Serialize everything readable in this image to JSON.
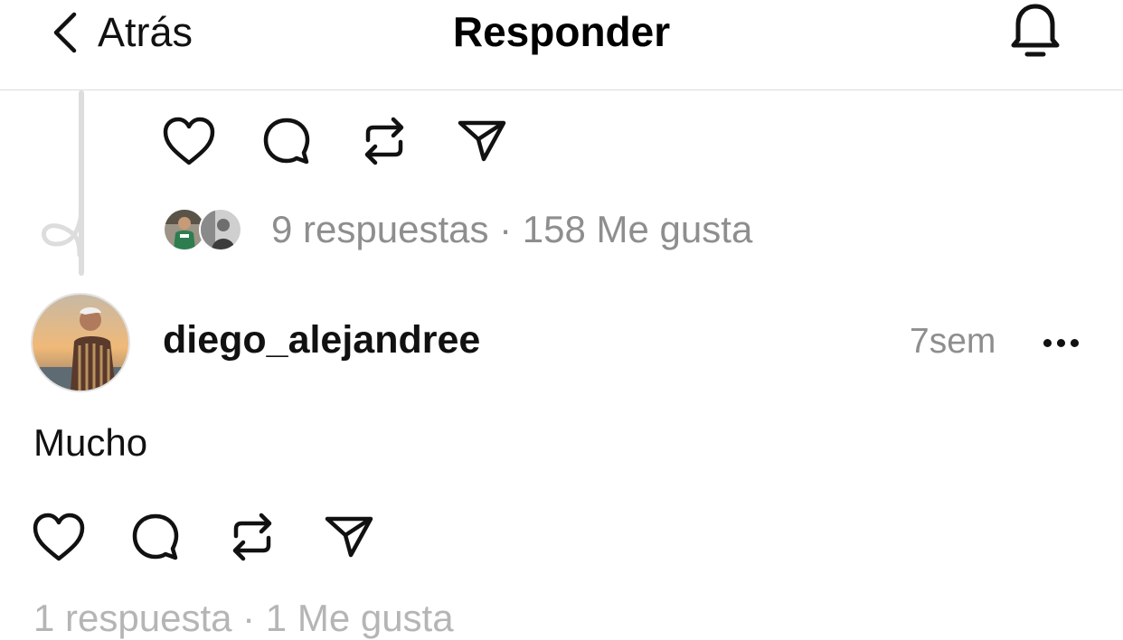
{
  "header": {
    "back_label": "Atrás",
    "title": "Responder",
    "icons": {
      "back": "chevron-left-icon",
      "notifications": "bell-icon"
    }
  },
  "previous_post": {
    "stats": "9 respuestas · 158 Me gusta"
  },
  "post": {
    "username": "diego_alejandree",
    "time": "7sem",
    "text": "Mucho",
    "stats": "1 respuesta · 1 Me gusta"
  },
  "action_icons": [
    "heart-icon",
    "comment-icon",
    "repost-icon",
    "share-icon"
  ],
  "colors": {
    "text": "#000000",
    "muted": "#8e8e8e",
    "divider": "#dcdcdc"
  }
}
